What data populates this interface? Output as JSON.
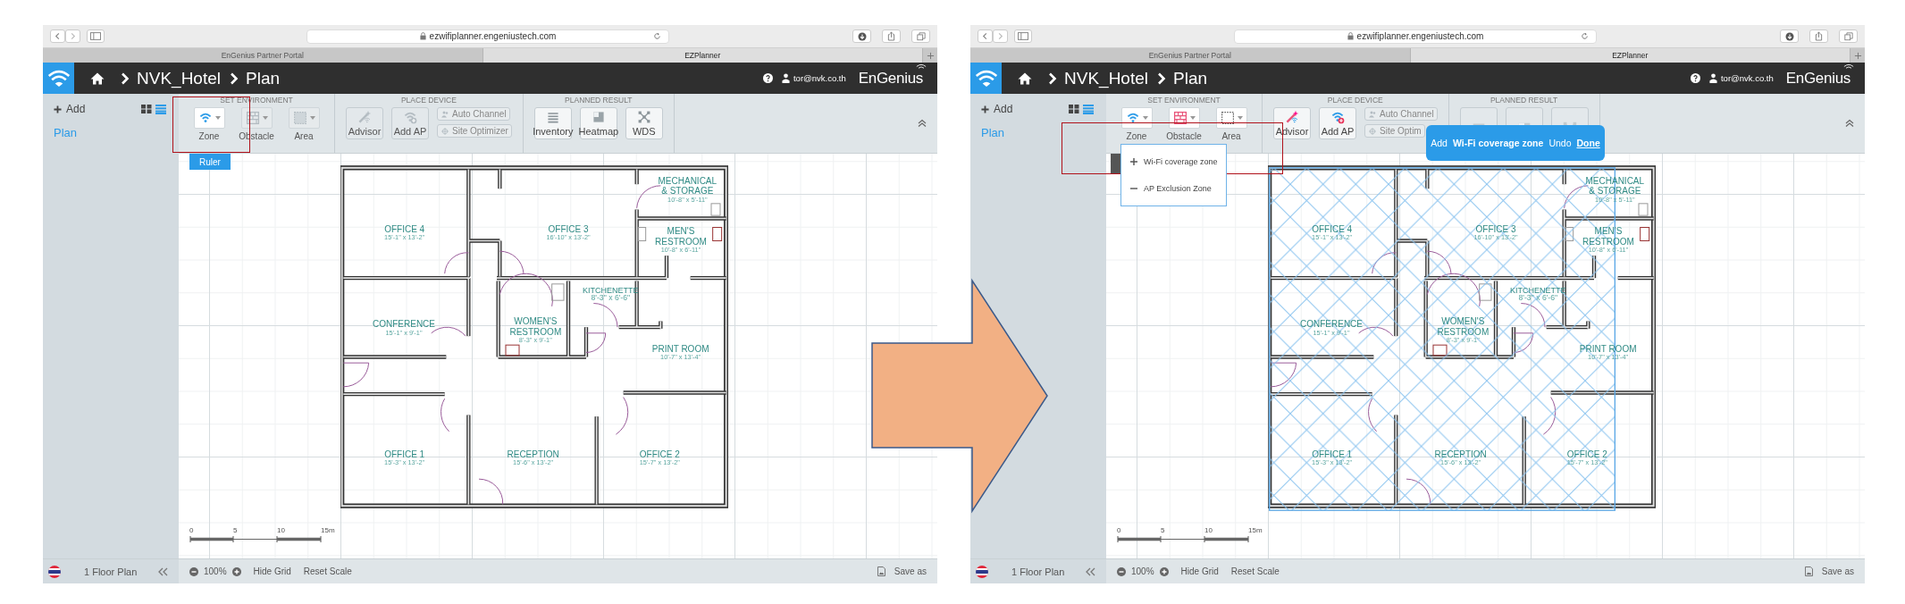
{
  "screens": [
    {
      "browser": {
        "url": "ezwifiplanner.engeniustech.com",
        "tabs": [
          {
            "label": "EnGenius Partner Portal",
            "selected": false
          },
          {
            "label": "EZPlanner",
            "selected": true
          }
        ]
      },
      "header": {
        "breadcrumb": [
          "NVK_Hotel",
          "Plan"
        ],
        "user": "tor@nvk.co.th",
        "brand": "EnGenius"
      },
      "sidebar": {
        "add": "Add",
        "view_modes": [
          {
            "kind": "grid",
            "selected": false
          },
          {
            "kind": "list",
            "selected": true
          }
        ],
        "items": [
          {
            "label": "Plan",
            "selected": true
          }
        ]
      },
      "ribbon": {
        "groups": [
          {
            "title": "SET ENVIRONMENT",
            "tools": [
              {
                "kind": "dropdown",
                "label": "Zone",
                "disabled": false
              },
              {
                "kind": "dropdown",
                "label": "Obstacle",
                "disabled": true
              },
              {
                "kind": "dropdown",
                "label": "Area",
                "disabled": true
              }
            ]
          },
          {
            "title": "PLACE DEVICE",
            "tools": [
              {
                "kind": "large",
                "label": "Advisor",
                "disabled": true
              },
              {
                "kind": "large",
                "label": "Add AP",
                "disabled": true
              },
              {
                "kind": "stack",
                "items": [
                  {
                    "label": "Auto Channel",
                    "disabled": true
                  },
                  {
                    "label": "Site Optimizer",
                    "disabled": true
                  }
                ]
              }
            ]
          },
          {
            "title": "PLANNED RESULT",
            "tools": [
              {
                "kind": "large",
                "label": "Inventory",
                "disabled": false
              },
              {
                "kind": "large",
                "label": "Heatmap",
                "disabled": false
              },
              {
                "kind": "large",
                "label": "WDS",
                "disabled": false
              }
            ]
          }
        ]
      },
      "canvas": {
        "ruler_button": "Ruler"
      },
      "floor_plan": {
        "coverage_zone": false,
        "rooms": [
          {
            "name": [
              "OFFICE 4"
            ],
            "size": "15'-1\" x 13'-2\""
          },
          {
            "name": [
              "OFFICE 3"
            ],
            "size": "16'-10\" x 13'-2\""
          },
          {
            "name": [
              "MECHANICAL",
              "& STORAGE"
            ],
            "size": "10'-8\" x 5'-11\""
          },
          {
            "name": [
              "MEN'S",
              "RESTROOM"
            ],
            "size": "10'-8\" x 6'-11\""
          },
          {
            "name": [
              "KITCHENETTE"
            ],
            "size": "8'-3\" x 6'-6\""
          },
          {
            "name": [
              "CONFERENCE"
            ],
            "size": "15'-1\" x 9'-1\""
          },
          {
            "name": [
              "WOMEN'S",
              "RESTROOM"
            ],
            "size": "8'-3\" x 9'-1\""
          },
          {
            "name": [
              "PRINT ROOM"
            ],
            "size": "10'-7\" x 13'-4\""
          },
          {
            "name": [
              "OFFICE 1"
            ],
            "size": "15'-3\" x 13'-2\""
          },
          {
            "name": [
              "RECEPTION"
            ],
            "size": "15'-6\" x 13'-2\""
          },
          {
            "name": [
              "OFFICE 2"
            ],
            "size": "15'-7\" x 13'-2\""
          }
        ]
      },
      "scale": {
        "ticks": [
          "0",
          "5",
          "10",
          "15m"
        ]
      },
      "footer": {
        "floors": "1 Floor Plan",
        "zoom": "100%",
        "actions": [
          "Hide Grid",
          "Reset Scale"
        ],
        "save": "Save as"
      }
    },
    {
      "browser": {
        "url": "ezwifiplanner.engeniustech.com",
        "tabs": [
          {
            "label": "EnGenius Partner Portal",
            "selected": false
          },
          {
            "label": "EZPlanner",
            "selected": true
          }
        ]
      },
      "header": {
        "breadcrumb": [
          "NVK_Hotel",
          "Plan"
        ],
        "user": "tor@nvk.co.th",
        "brand": "EnGenius"
      },
      "sidebar": {
        "add": "Add",
        "view_modes": [
          {
            "kind": "grid",
            "selected": false
          },
          {
            "kind": "list",
            "selected": true
          }
        ],
        "items": [
          {
            "label": "Plan",
            "selected": true
          }
        ]
      },
      "ribbon": {
        "groups": [
          {
            "title": "SET ENVIRONMENT",
            "tools": [
              {
                "kind": "dropdown",
                "label": "Zone",
                "disabled": false
              },
              {
                "kind": "dropdown",
                "label": "Obstacle",
                "disabled": false
              },
              {
                "kind": "dropdown",
                "label": "Area",
                "disabled": false
              }
            ]
          },
          {
            "title": "PLACE DEVICE",
            "tools": [
              {
                "kind": "large",
                "label": "Advisor",
                "disabled": false
              },
              {
                "kind": "large",
                "label": "Add AP",
                "disabled": false
              },
              {
                "kind": "stack",
                "items": [
                  {
                    "label": "Auto Channel",
                    "disabled": true
                  },
                  {
                    "label": "Site Optim",
                    "disabled": true
                  }
                ]
              }
            ]
          },
          {
            "title": "PLANNED RESULT",
            "tools": [
              {
                "kind": "large",
                "disabled": true
              },
              {
                "kind": "large",
                "disabled": true
              },
              {
                "kind": "large",
                "disabled": true
              }
            ]
          }
        ]
      },
      "zone_menu": {
        "items": [
          {
            "kind": "add",
            "label": "Wi-Fi coverage zone"
          },
          {
            "kind": "remove",
            "label": "AP Exclusion Zone"
          }
        ]
      },
      "zone_prompt": {
        "action": "Add",
        "target": "Wi-Fi coverage zone",
        "undo": "Undo",
        "done": "Done"
      },
      "floor_plan": {
        "coverage_zone": true,
        "rooms": [
          {
            "name": [
              "OFFICE 4"
            ],
            "size": "15'-1\" x 13'-2\""
          },
          {
            "name": [
              "OFFICE 3"
            ],
            "size": "16'-10\" x 13'-2\""
          },
          {
            "name": [
              "MECHANICAL",
              "& STORAGE"
            ],
            "size": "10'-8\" x 5'-11\""
          },
          {
            "name": [
              "MEN'S",
              "RESTROOM"
            ],
            "size": "10'-8\" x 6'-11\""
          },
          {
            "name": [
              "KITCHENETTE"
            ],
            "size": "8'-3\" x 6'-6\""
          },
          {
            "name": [
              "CONFERENCE"
            ],
            "size": "15'-1\" x 9'-1\""
          },
          {
            "name": [
              "WOMEN'S",
              "RESTROOM"
            ],
            "size": "8'-3\" x 9'-1\""
          },
          {
            "name": [
              "PRINT ROOM"
            ],
            "size": "10'-7\" x 13'-4\""
          },
          {
            "name": [
              "OFFICE 1"
            ],
            "size": "15'-3\" x 13'-2\""
          },
          {
            "name": [
              "RECEPTION"
            ],
            "size": "15'-6\" x 13'-2\""
          },
          {
            "name": [
              "OFFICE 2"
            ],
            "size": "15'-7\" x 13'-2\""
          }
        ]
      },
      "scale": {
        "ticks": [
          "0",
          "5",
          "10",
          "15m"
        ]
      },
      "footer": {
        "floors": "1 Floor Plan",
        "zoom": "100%",
        "actions": [
          "Hide Grid",
          "Reset Scale"
        ],
        "save": "Save as"
      }
    }
  ]
}
